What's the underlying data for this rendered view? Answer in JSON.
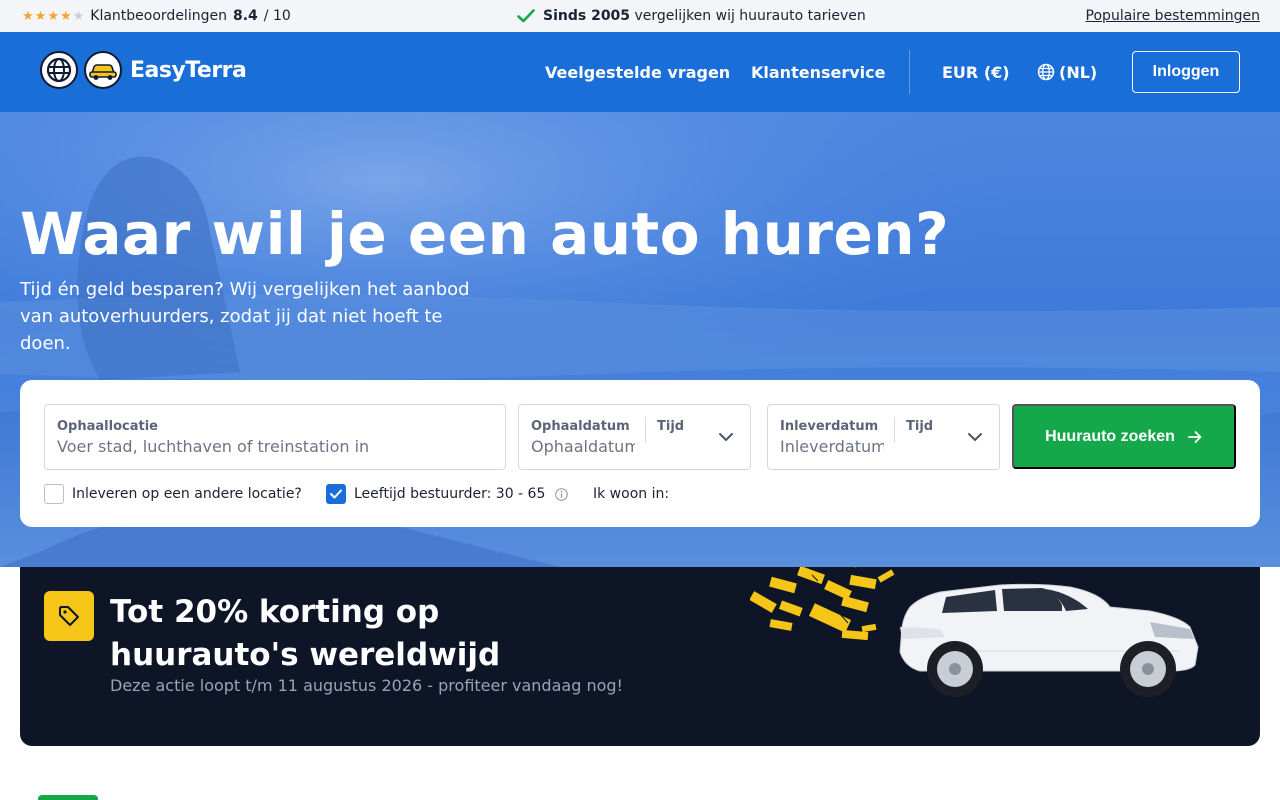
{
  "topbar": {
    "stars_filled": 4,
    "stars_total": 5,
    "rating_label": "Klantbeoordelingen",
    "rating_score": "8.4",
    "rating_max": "/ 10",
    "since_bold": "Sinds 2005",
    "since_text": "vergelijken wij huurauto tarieven",
    "popular_link": "Populaire bestemmingen"
  },
  "header": {
    "brand": "EasyTerra",
    "nav_faq": "Veelgestelde vragen",
    "nav_service": "Klantenservice",
    "currency": "EUR (€)",
    "language": "(NL)",
    "login": "Inloggen"
  },
  "hero": {
    "title": "Waar wil je een auto huren?",
    "subtitle": "Tijd én geld besparen? Wij vergelijken het aanbod van autoverhuurders, zodat jij dat niet hoeft te doen."
  },
  "search": {
    "location_label": "Ophaallocatie",
    "location_placeholder": "Voer stad, luchthaven of treinstation in",
    "pickup_date_label": "Ophaaldatum",
    "pickup_date_placeholder": "Ophaaldatum",
    "pickup_time_label": "Tijd",
    "return_date_label": "Inleverdatum",
    "return_date_placeholder": "Inleverdatum",
    "return_time_label": "Tijd",
    "submit": "Huurauto zoeken",
    "other_location": "Inleveren op een andere locatie?",
    "driver_age": "Leeftijd bestuurder: 30 - 65",
    "residence": "Ik woon in:",
    "driver_age_checked": true,
    "other_location_checked": false
  },
  "promo": {
    "title": "Tot 20% korting op huurauto's wereldwijd",
    "subtitle": "Deze actie loopt t/m 11 augustus 2026 - profiteer vandaag nog!"
  },
  "colors": {
    "brand_blue": "#1a6ed8",
    "cta_green": "#14a84a",
    "promo_dark": "#0d1527",
    "promo_yellow": "#f5c518",
    "star": "#f2a533"
  }
}
